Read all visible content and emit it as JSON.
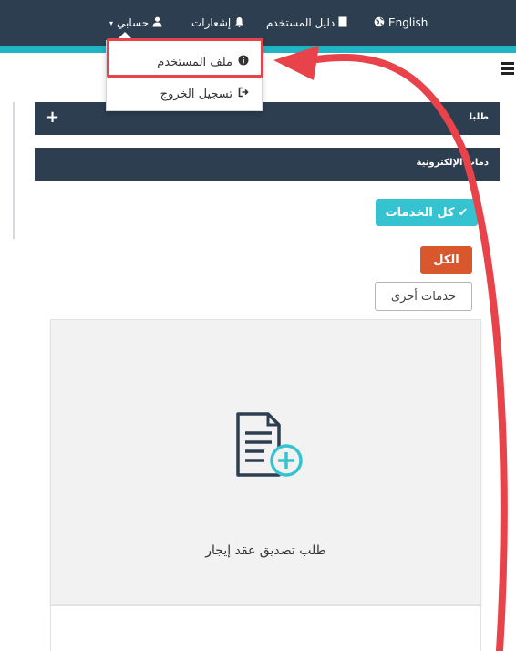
{
  "topbar": {
    "language_label": "English",
    "user_guide_label": "دليل المستخدم",
    "notifications_label": "إشعارات",
    "my_account_label": "حسابي"
  },
  "panels": {
    "requests_label": "طلبا",
    "eservices_label": "دمات الإلكترونية"
  },
  "filters": {
    "all_services_label": "كل الخدمات",
    "all_label": "الكل",
    "other_services_label": "خدمات أخرى"
  },
  "dropdown": {
    "profile_label": "ملف المستخدم",
    "logout_label": "تسجيل الخروج"
  },
  "service_card": {
    "title": "طلب تصديق عقد إيجار",
    "icon": "document-add-icon"
  },
  "colors": {
    "navbar": "#2c3e50",
    "accent_teal": "#36c3d1",
    "accent_orange": "#d9572c",
    "annotation_red": "#e8424a"
  }
}
